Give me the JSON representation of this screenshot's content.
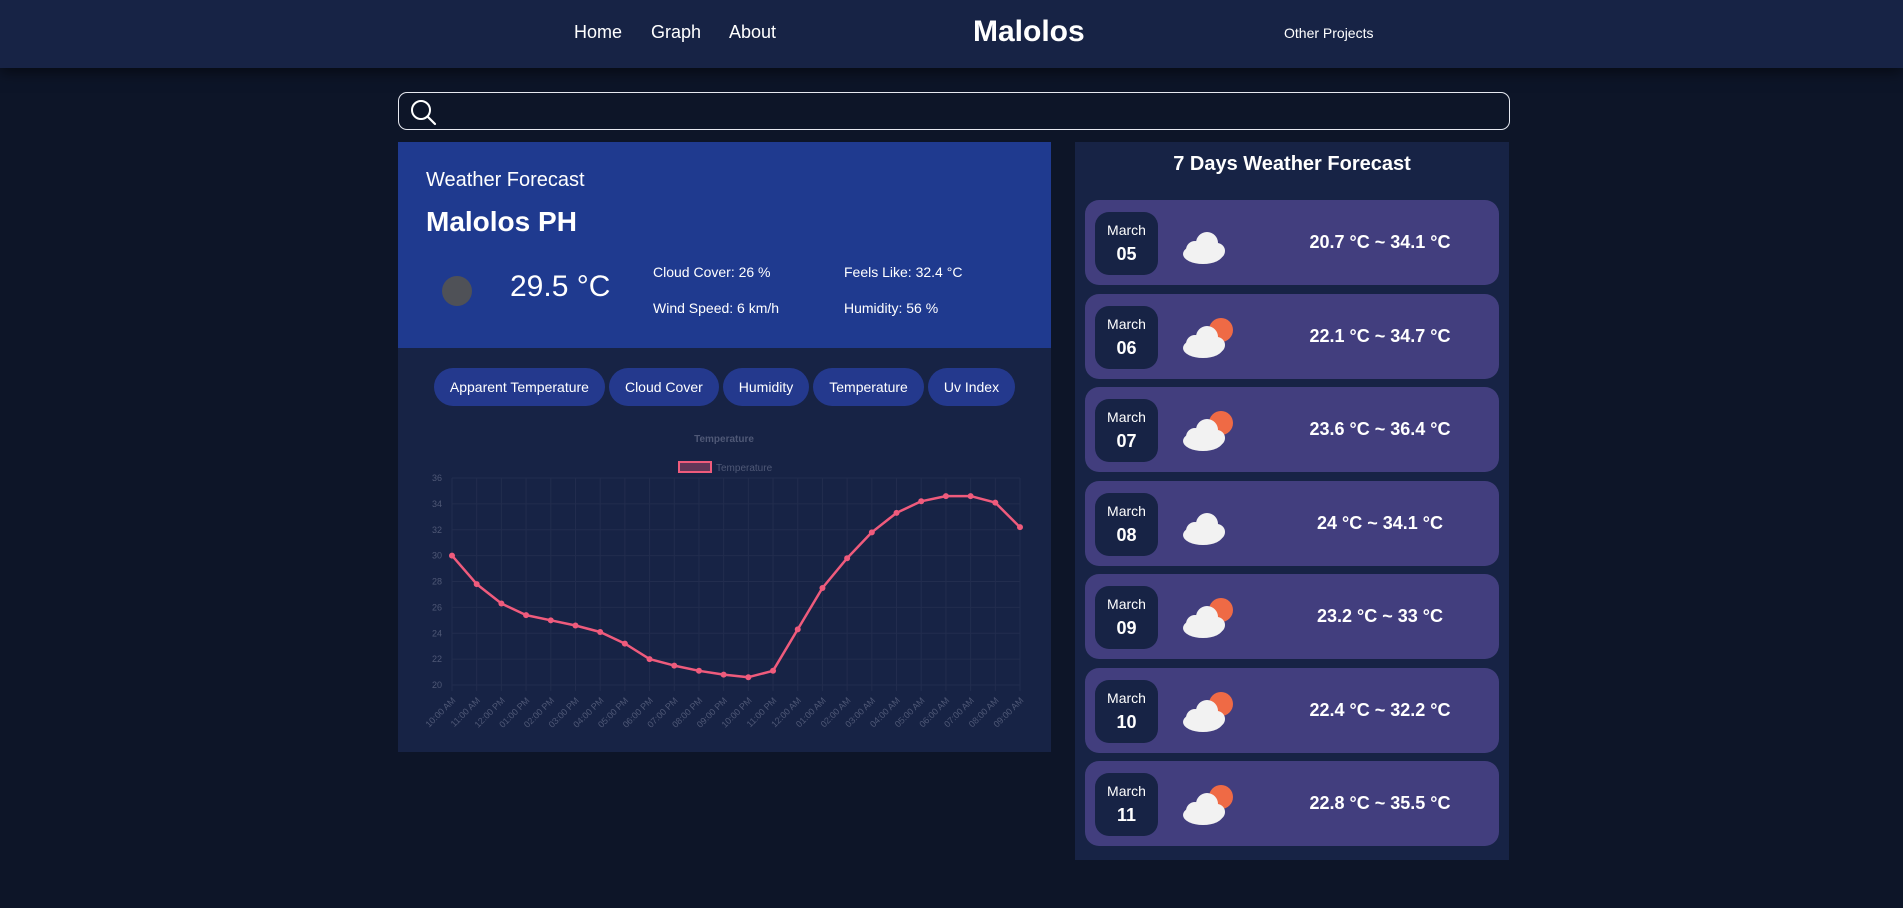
{
  "nav": {
    "home": "Home",
    "graph": "Graph",
    "about": "About",
    "brand": "Malolos",
    "other_projects": "Other Projects"
  },
  "search": {
    "value": "",
    "placeholder": ""
  },
  "current": {
    "heading": "Weather Forecast",
    "location": "Malolos PH",
    "temperature": "29.5 °C",
    "cloud_cover": "Cloud Cover: 26 %",
    "feels_like": "Feels Like: 32.4 °C",
    "wind_speed": "Wind Speed: 6 km/h",
    "humidity": "Humidity: 56 %"
  },
  "tabs": [
    {
      "label": "Apparent Temperature"
    },
    {
      "label": "Cloud Cover"
    },
    {
      "label": "Humidity"
    },
    {
      "label": "Temperature"
    },
    {
      "label": "Uv Index"
    }
  ],
  "chart_data": {
    "type": "line",
    "title": "Temperature",
    "legend": "top",
    "grid": true,
    "ylim": [
      20,
      36
    ],
    "yticks": [
      20,
      22,
      24,
      26,
      28,
      30,
      32,
      34,
      36
    ],
    "x": [
      "10:00 AM",
      "11:00 AM",
      "12:00 PM",
      "01:00 PM",
      "02:00 PM",
      "03:00 PM",
      "04:00 PM",
      "05:00 PM",
      "06:00 PM",
      "07:00 PM",
      "08:00 PM",
      "09:00 PM",
      "10:00 PM",
      "11:00 PM",
      "12:00 AM",
      "01:00 AM",
      "02:00 AM",
      "03:00 AM",
      "04:00 AM",
      "05:00 AM",
      "06:00 AM",
      "07:00 AM",
      "08:00 AM",
      "09:00 AM"
    ],
    "series": [
      {
        "name": "Temperature",
        "color": "#ef5b7c",
        "values": [
          30.0,
          27.8,
          26.3,
          25.4,
          25.0,
          24.6,
          24.1,
          23.2,
          22.0,
          21.5,
          21.1,
          20.8,
          20.6,
          21.1,
          24.3,
          27.5,
          29.8,
          31.8,
          33.3,
          34.2,
          34.6,
          34.6,
          34.1,
          32.2
        ]
      }
    ]
  },
  "forecast": {
    "title": "7 Days Weather Forecast",
    "days": [
      {
        "month": "March",
        "day": "05",
        "range": "20.7 °C ~ 34.1 °C",
        "icon": "cloud-icon"
      },
      {
        "month": "March",
        "day": "06",
        "range": "22.1 °C ~ 34.7 °C",
        "icon": "partly-cloudy-icon"
      },
      {
        "month": "March",
        "day": "07",
        "range": "23.6 °C ~ 36.4 °C",
        "icon": "partly-cloudy-icon"
      },
      {
        "month": "March",
        "day": "08",
        "range": "24 °C ~ 34.1 °C",
        "icon": "cloud-icon"
      },
      {
        "month": "March",
        "day": "09",
        "range": "23.2 °C ~ 33 °C",
        "icon": "partly-cloudy-icon"
      },
      {
        "month": "March",
        "day": "10",
        "range": "22.4 °C ~ 32.2 °C",
        "icon": "partly-cloudy-icon"
      },
      {
        "month": "March",
        "day": "11",
        "range": "22.8 °C ~ 35.5 °C",
        "icon": "partly-cloudy-icon"
      }
    ]
  },
  "colors": {
    "background": "#0d1528",
    "panel": "#172345",
    "current_card": "#1f3a8f",
    "tab": "#24398d",
    "day_card": "#423e7e",
    "sun": "#ef6a45"
  }
}
